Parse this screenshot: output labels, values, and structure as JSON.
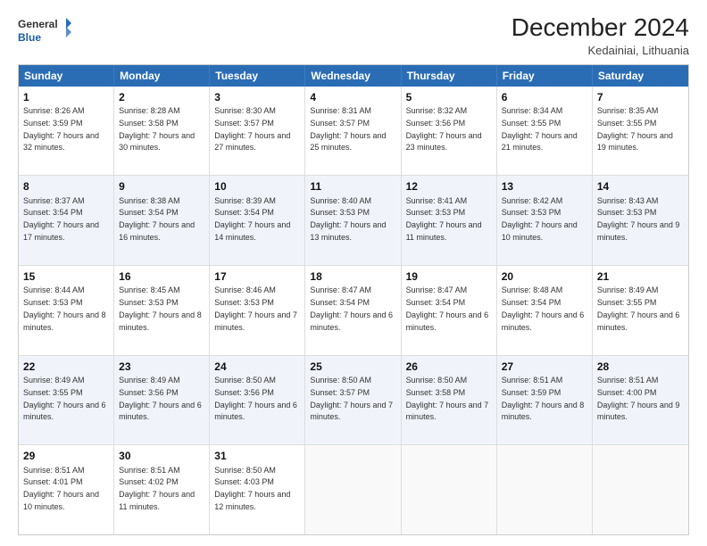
{
  "header": {
    "logo_line1": "General",
    "logo_line2": "Blue",
    "title": "December 2024",
    "subtitle": "Kedainiai, Lithuania"
  },
  "weekdays": [
    "Sunday",
    "Monday",
    "Tuesday",
    "Wednesday",
    "Thursday",
    "Friday",
    "Saturday"
  ],
  "rows": [
    [
      {
        "day": "1",
        "sunrise": "Sunrise: 8:26 AM",
        "sunset": "Sunset: 3:59 PM",
        "daylight": "Daylight: 7 hours and 32 minutes.",
        "shaded": false
      },
      {
        "day": "2",
        "sunrise": "Sunrise: 8:28 AM",
        "sunset": "Sunset: 3:58 PM",
        "daylight": "Daylight: 7 hours and 30 minutes.",
        "shaded": false
      },
      {
        "day": "3",
        "sunrise": "Sunrise: 8:30 AM",
        "sunset": "Sunset: 3:57 PM",
        "daylight": "Daylight: 7 hours and 27 minutes.",
        "shaded": false
      },
      {
        "day": "4",
        "sunrise": "Sunrise: 8:31 AM",
        "sunset": "Sunset: 3:57 PM",
        "daylight": "Daylight: 7 hours and 25 minutes.",
        "shaded": false
      },
      {
        "day": "5",
        "sunrise": "Sunrise: 8:32 AM",
        "sunset": "Sunset: 3:56 PM",
        "daylight": "Daylight: 7 hours and 23 minutes.",
        "shaded": false
      },
      {
        "day": "6",
        "sunrise": "Sunrise: 8:34 AM",
        "sunset": "Sunset: 3:55 PM",
        "daylight": "Daylight: 7 hours and 21 minutes.",
        "shaded": false
      },
      {
        "day": "7",
        "sunrise": "Sunrise: 8:35 AM",
        "sunset": "Sunset: 3:55 PM",
        "daylight": "Daylight: 7 hours and 19 minutes.",
        "shaded": false
      }
    ],
    [
      {
        "day": "8",
        "sunrise": "Sunrise: 8:37 AM",
        "sunset": "Sunset: 3:54 PM",
        "daylight": "Daylight: 7 hours and 17 minutes.",
        "shaded": true
      },
      {
        "day": "9",
        "sunrise": "Sunrise: 8:38 AM",
        "sunset": "Sunset: 3:54 PM",
        "daylight": "Daylight: 7 hours and 16 minutes.",
        "shaded": true
      },
      {
        "day": "10",
        "sunrise": "Sunrise: 8:39 AM",
        "sunset": "Sunset: 3:54 PM",
        "daylight": "Daylight: 7 hours and 14 minutes.",
        "shaded": true
      },
      {
        "day": "11",
        "sunrise": "Sunrise: 8:40 AM",
        "sunset": "Sunset: 3:53 PM",
        "daylight": "Daylight: 7 hours and 13 minutes.",
        "shaded": true
      },
      {
        "day": "12",
        "sunrise": "Sunrise: 8:41 AM",
        "sunset": "Sunset: 3:53 PM",
        "daylight": "Daylight: 7 hours and 11 minutes.",
        "shaded": true
      },
      {
        "day": "13",
        "sunrise": "Sunrise: 8:42 AM",
        "sunset": "Sunset: 3:53 PM",
        "daylight": "Daylight: 7 hours and 10 minutes.",
        "shaded": true
      },
      {
        "day": "14",
        "sunrise": "Sunrise: 8:43 AM",
        "sunset": "Sunset: 3:53 PM",
        "daylight": "Daylight: 7 hours and 9 minutes.",
        "shaded": true
      }
    ],
    [
      {
        "day": "15",
        "sunrise": "Sunrise: 8:44 AM",
        "sunset": "Sunset: 3:53 PM",
        "daylight": "Daylight: 7 hours and 8 minutes.",
        "shaded": false
      },
      {
        "day": "16",
        "sunrise": "Sunrise: 8:45 AM",
        "sunset": "Sunset: 3:53 PM",
        "daylight": "Daylight: 7 hours and 8 minutes.",
        "shaded": false
      },
      {
        "day": "17",
        "sunrise": "Sunrise: 8:46 AM",
        "sunset": "Sunset: 3:53 PM",
        "daylight": "Daylight: 7 hours and 7 minutes.",
        "shaded": false
      },
      {
        "day": "18",
        "sunrise": "Sunrise: 8:47 AM",
        "sunset": "Sunset: 3:54 PM",
        "daylight": "Daylight: 7 hours and 6 minutes.",
        "shaded": false
      },
      {
        "day": "19",
        "sunrise": "Sunrise: 8:47 AM",
        "sunset": "Sunset: 3:54 PM",
        "daylight": "Daylight: 7 hours and 6 minutes.",
        "shaded": false
      },
      {
        "day": "20",
        "sunrise": "Sunrise: 8:48 AM",
        "sunset": "Sunset: 3:54 PM",
        "daylight": "Daylight: 7 hours and 6 minutes.",
        "shaded": false
      },
      {
        "day": "21",
        "sunrise": "Sunrise: 8:49 AM",
        "sunset": "Sunset: 3:55 PM",
        "daylight": "Daylight: 7 hours and 6 minutes.",
        "shaded": false
      }
    ],
    [
      {
        "day": "22",
        "sunrise": "Sunrise: 8:49 AM",
        "sunset": "Sunset: 3:55 PM",
        "daylight": "Daylight: 7 hours and 6 minutes.",
        "shaded": true
      },
      {
        "day": "23",
        "sunrise": "Sunrise: 8:49 AM",
        "sunset": "Sunset: 3:56 PM",
        "daylight": "Daylight: 7 hours and 6 minutes.",
        "shaded": true
      },
      {
        "day": "24",
        "sunrise": "Sunrise: 8:50 AM",
        "sunset": "Sunset: 3:56 PM",
        "daylight": "Daylight: 7 hours and 6 minutes.",
        "shaded": true
      },
      {
        "day": "25",
        "sunrise": "Sunrise: 8:50 AM",
        "sunset": "Sunset: 3:57 PM",
        "daylight": "Daylight: 7 hours and 7 minutes.",
        "shaded": true
      },
      {
        "day": "26",
        "sunrise": "Sunrise: 8:50 AM",
        "sunset": "Sunset: 3:58 PM",
        "daylight": "Daylight: 7 hours and 7 minutes.",
        "shaded": true
      },
      {
        "day": "27",
        "sunrise": "Sunrise: 8:51 AM",
        "sunset": "Sunset: 3:59 PM",
        "daylight": "Daylight: 7 hours and 8 minutes.",
        "shaded": true
      },
      {
        "day": "28",
        "sunrise": "Sunrise: 8:51 AM",
        "sunset": "Sunset: 4:00 PM",
        "daylight": "Daylight: 7 hours and 9 minutes.",
        "shaded": true
      }
    ],
    [
      {
        "day": "29",
        "sunrise": "Sunrise: 8:51 AM",
        "sunset": "Sunset: 4:01 PM",
        "daylight": "Daylight: 7 hours and 10 minutes.",
        "shaded": false
      },
      {
        "day": "30",
        "sunrise": "Sunrise: 8:51 AM",
        "sunset": "Sunset: 4:02 PM",
        "daylight": "Daylight: 7 hours and 11 minutes.",
        "shaded": false
      },
      {
        "day": "31",
        "sunrise": "Sunrise: 8:50 AM",
        "sunset": "Sunset: 4:03 PM",
        "daylight": "Daylight: 7 hours and 12 minutes.",
        "shaded": false
      },
      {
        "day": "",
        "sunrise": "",
        "sunset": "",
        "daylight": "",
        "shaded": false,
        "empty": true
      },
      {
        "day": "",
        "sunrise": "",
        "sunset": "",
        "daylight": "",
        "shaded": false,
        "empty": true
      },
      {
        "day": "",
        "sunrise": "",
        "sunset": "",
        "daylight": "",
        "shaded": false,
        "empty": true
      },
      {
        "day": "",
        "sunrise": "",
        "sunset": "",
        "daylight": "",
        "shaded": false,
        "empty": true
      }
    ]
  ]
}
